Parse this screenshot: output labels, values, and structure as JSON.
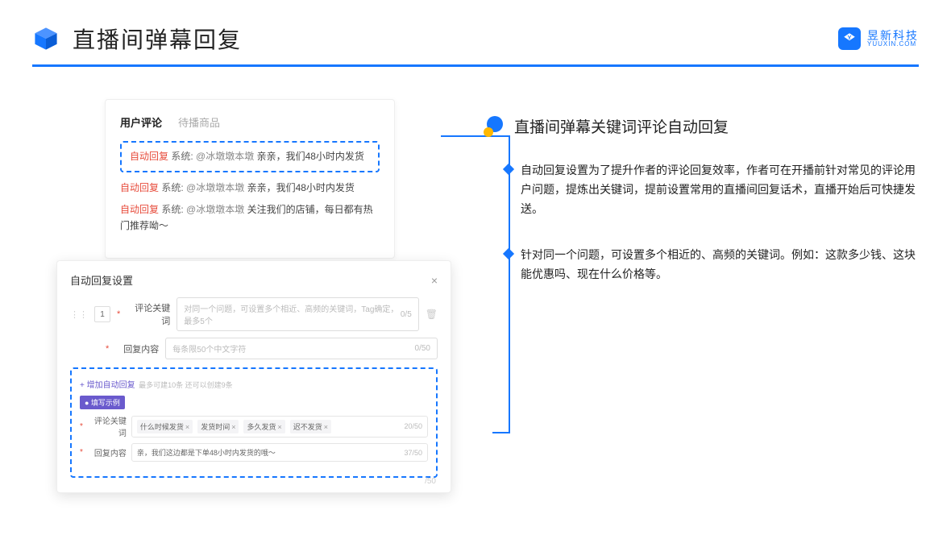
{
  "header": {
    "title": "直播间弹幕回复",
    "brand_cn": "昱新科技",
    "brand_en": "YUUXIN.COM"
  },
  "comments": {
    "tab_active": "用户评论",
    "tab_inactive": "待播商品",
    "highlighted": {
      "auto": "自动回复",
      "sys": "系统:",
      "user": "@冰墩墩本墩",
      "msg": "亲亲，我们48小时内发货"
    },
    "line2": {
      "auto": "自动回复",
      "sys": "系统:",
      "user": "@冰墩墩本墩",
      "msg": "亲亲，我们48小时内发货"
    },
    "line3": {
      "auto": "自动回复",
      "sys": "系统:",
      "user": "@冰墩墩本墩",
      "msg": "关注我们的店铺，每日都有热门推荐呦～"
    }
  },
  "settings": {
    "title": "自动回复设置",
    "idx": "1",
    "kw_label": "评论关键词",
    "kw_placeholder": "对同一个问题，可设置多个相近、高频的关键词，Tag确定，最多5个",
    "kw_counter": "0/5",
    "content_label": "回复内容",
    "content_placeholder": "每条限50个中文字符",
    "content_counter": "0/50",
    "add_link": "+ 增加自动回复",
    "add_hint": "最多可建10条 还可以创建9条",
    "example_badge": "● 填写示例",
    "ex_kw_label": "评论关键词",
    "ex_tags": [
      "什么时候发货",
      "发货时间",
      "多久发货",
      "迟不发货"
    ],
    "ex_kw_counter": "20/50",
    "ex_content_label": "回复内容",
    "ex_content_text": "亲，我们这边都是下单48小时内发货的哦～",
    "ex_content_counter": "37/50",
    "outer_counter": "/50"
  },
  "right": {
    "section_title": "直播间弹幕关键词评论自动回复",
    "bullet1": "自动回复设置为了提升作者的评论回复效率，作者可在开播前针对常见的评论用户问题，提炼出关键词，提前设置常用的直播间回复话术，直播开始后可快捷发送。",
    "bullet2": "针对同一个问题，可设置多个相近的、高频的关键词。例如：这款多少钱、这块能优惠吗、现在什么价格等。"
  }
}
